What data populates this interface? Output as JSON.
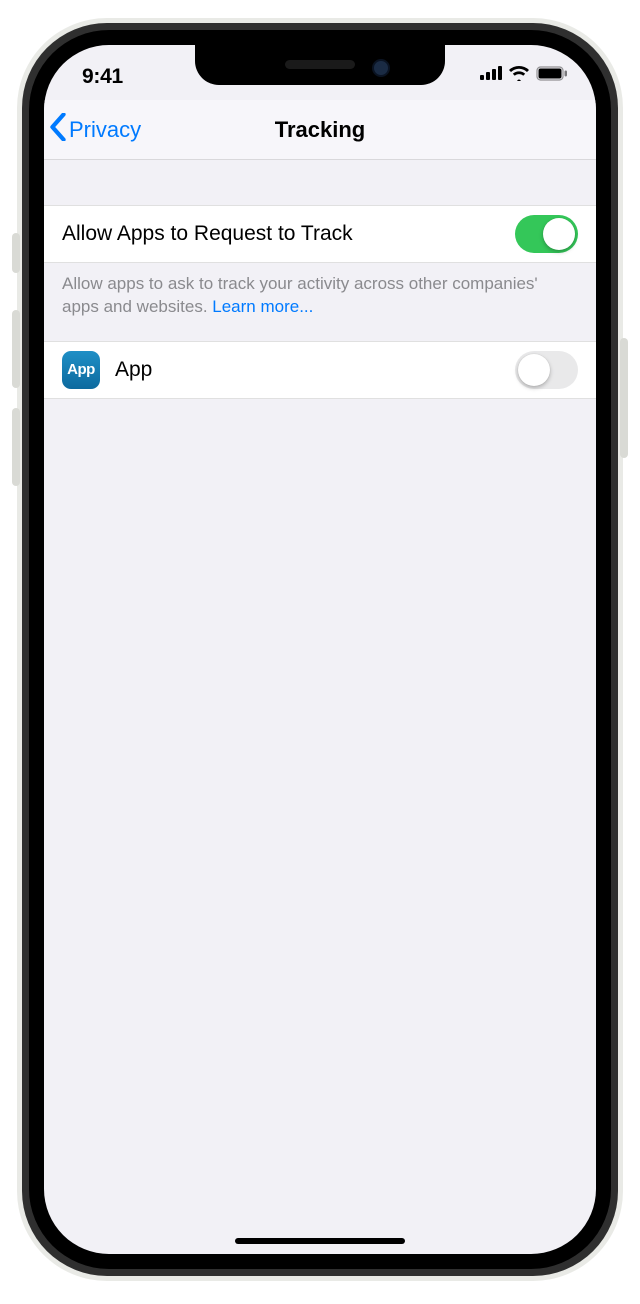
{
  "status": {
    "time": "9:41"
  },
  "nav": {
    "back_label": "Privacy",
    "title": "Tracking"
  },
  "main": {
    "allow_label": "Allow Apps to Request to Track",
    "allow_on": true,
    "footer_text": "Allow apps to ask to track your activity across other companies' apps and websites. ",
    "footer_link": "Learn more..."
  },
  "app_row": {
    "icon_text": "App",
    "name": "App",
    "on": false
  },
  "colors": {
    "accent": "#007aff",
    "toggle_on": "#34c759"
  }
}
